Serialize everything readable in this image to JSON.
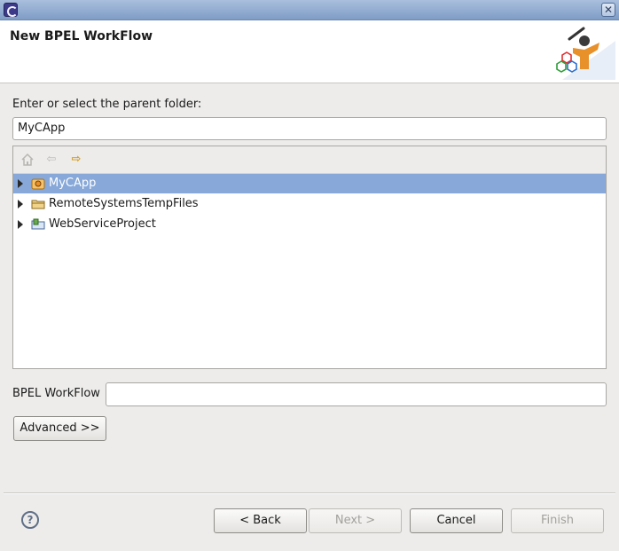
{
  "window": {
    "close_glyph": "✕"
  },
  "header": {
    "title": "New BPEL WorkFlow"
  },
  "folder": {
    "prompt_label": "Enter or select the parent folder:",
    "value": "MyCApp"
  },
  "toolbar": {
    "home_icon": "home-icon",
    "back_glyph": "⇦",
    "forward_glyph": "⇨"
  },
  "tree": {
    "items": [
      {
        "label": "MyCApp",
        "selected": true,
        "icon": "project-icon"
      },
      {
        "label": "RemoteSystemsTempFiles",
        "selected": false,
        "icon": "folder-icon"
      },
      {
        "label": "WebServiceProject",
        "selected": false,
        "icon": "java-project-icon"
      }
    ]
  },
  "workflow": {
    "label": "BPEL WorkFlow",
    "value": ""
  },
  "buttons": {
    "advanced": "Advanced >>",
    "back": "< Back",
    "next": "Next >",
    "cancel": "Cancel",
    "finish": "Finish"
  },
  "help": {
    "glyph": "?"
  },
  "colors": {
    "selection": "#87a8d8",
    "title_bar": "#8ea8cf",
    "accent_orange": "#e8902a"
  }
}
